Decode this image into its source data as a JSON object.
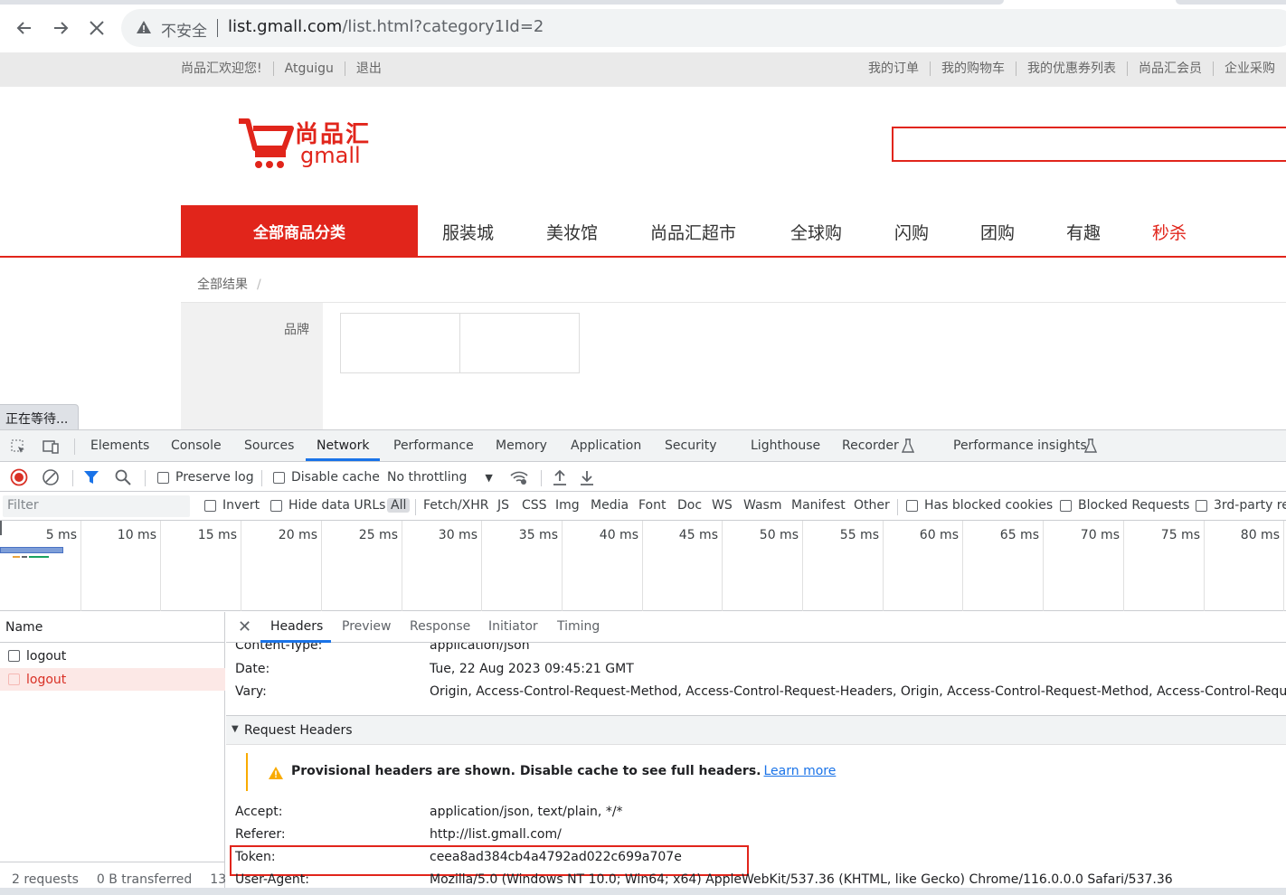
{
  "browser": {
    "insecure_label": "不安全",
    "url_host": "list.gmall.com",
    "url_path": "/list.html?category1Id=2"
  },
  "site": {
    "topbar_left": [
      "尚品汇欢迎您!",
      "Atguigu",
      "退出"
    ],
    "topbar_right": [
      "我的订单",
      "我的购物车",
      "我的优惠券列表",
      "尚品汇会员",
      "企业采购"
    ],
    "logo_cn": "尚品汇",
    "logo_en": "gmall",
    "all_categories": "全部商品分类",
    "nav": [
      "服装城",
      "美妆馆",
      "尚品汇超市",
      "全球购",
      "闪购",
      "团购",
      "有趣",
      "秒杀"
    ],
    "breadcrumb": "全部结果",
    "breadcrumb_sep": "/",
    "brand_label": "品牌",
    "status": "正在等待..."
  },
  "devtools": {
    "tabs": [
      "Elements",
      "Console",
      "Sources",
      "Network",
      "Performance",
      "Memory",
      "Application",
      "Security",
      "Lighthouse",
      "Recorder",
      "Performance insights"
    ],
    "active_tab": "Network",
    "toolbar": {
      "preserve_log": "Preserve log",
      "disable_cache": "Disable cache",
      "throttling": "No throttling"
    },
    "filter": {
      "placeholder": "Filter",
      "invert": "Invert",
      "hide_data_urls": "Hide data URLs",
      "types": [
        "All",
        "Fetch/XHR",
        "JS",
        "CSS",
        "Img",
        "Media",
        "Font",
        "Doc",
        "WS",
        "Wasm",
        "Manifest",
        "Other"
      ],
      "has_blocked_cookies": "Has blocked cookies",
      "blocked_requests": "Blocked Requests",
      "third_party": "3rd-party re"
    },
    "timeline_ticks": [
      "5 ms",
      "10 ms",
      "15 ms",
      "20 ms",
      "25 ms",
      "30 ms",
      "35 ms",
      "40 ms",
      "45 ms",
      "50 ms",
      "55 ms",
      "60 ms",
      "65 ms",
      "70 ms",
      "75 ms",
      "80 ms"
    ],
    "requests": {
      "header": "Name",
      "rows": [
        "logout",
        "logout"
      ],
      "footer_count": "2 requests",
      "footer_transferred": "0 B transferred",
      "footer_more": "13"
    },
    "detail": {
      "tabs": [
        "Headers",
        "Preview",
        "Response",
        "Initiator",
        "Timing"
      ],
      "response_headers": [
        {
          "name": "Content-Type:",
          "value": "application/json"
        },
        {
          "name": "Date:",
          "value": "Tue, 22 Aug 2023 09:45:21 GMT"
        },
        {
          "name": "Vary:",
          "value": "Origin, Access-Control-Request-Method, Access-Control-Request-Headers, Origin, Access-Control-Request-Method, Access-Control-Request-H"
        }
      ],
      "request_section": "Request Headers",
      "notice": "Provisional headers are shown. Disable cache to see full headers.",
      "learn_more": "Learn more",
      "request_headers": [
        {
          "name": "Accept:",
          "value": "application/json, text/plain, */*"
        },
        {
          "name": "Referer:",
          "value": "http://list.gmall.com/"
        },
        {
          "name": "Token:",
          "value": "ceea8ad384cb4a4792ad022c699a707e"
        },
        {
          "name": "User-Agent:",
          "value": "Mozilla/5.0 (Windows NT 10.0; Win64; x64) AppleWebKit/537.36 (KHTML, like Gecko) Chrome/116.0.0.0 Safari/537.36"
        }
      ]
    }
  },
  "colors": {
    "brand_red": "#e1251b",
    "devtools_blue": "#1a73e8"
  }
}
